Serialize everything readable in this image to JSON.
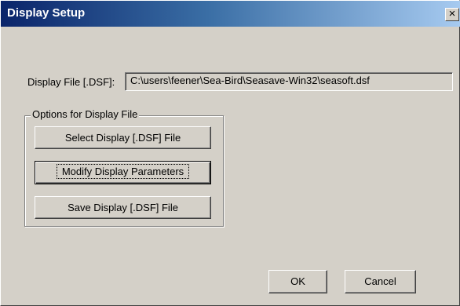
{
  "window": {
    "title": "Display Setup",
    "close_glyph": "×"
  },
  "display_file": {
    "label": "Display File [.DSF]:",
    "value": "C:\\users\\feener\\Sea-Bird\\Seasave-Win32\\seasoft.dsf"
  },
  "options": {
    "legend": "Options for Display File",
    "select_label": "Select Display [.DSF] File",
    "modify_label": "Modify Display Parameters",
    "save_label": "Save Display [.DSF] File"
  },
  "footer": {
    "ok_label": "OK",
    "cancel_label": "Cancel"
  }
}
